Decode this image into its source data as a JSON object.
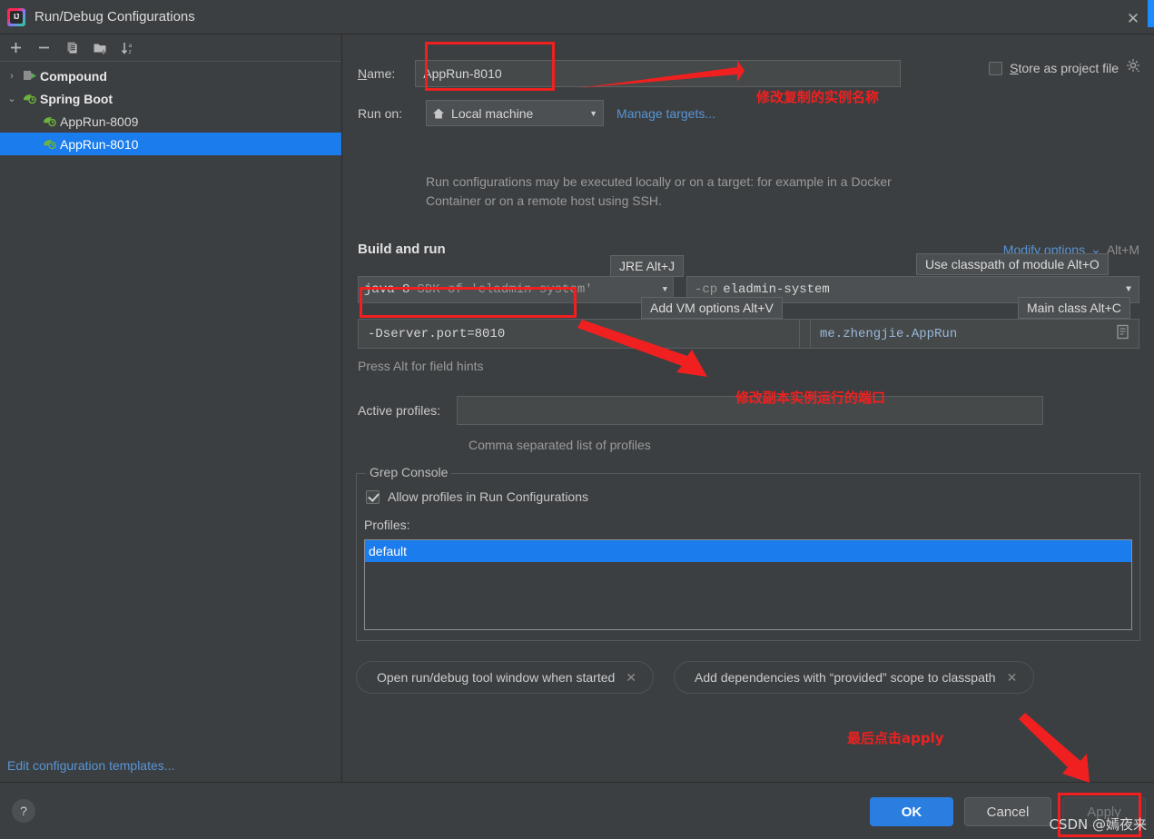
{
  "window": {
    "title": "Run/Debug Configurations",
    "logo_icon": "intellij-idea-logo",
    "close_icon": "close-icon"
  },
  "sidebar": {
    "toolbar": [
      {
        "name": "add-configuration-button",
        "icon": "plus-icon",
        "label": "+"
      },
      {
        "name": "remove-configuration-button",
        "icon": "minus-icon",
        "label": "−"
      },
      {
        "name": "copy-configuration-button",
        "icon": "copy-icon",
        "label": "copy"
      },
      {
        "name": "new-folder-button",
        "icon": "folder-add-icon",
        "label": "folder"
      },
      {
        "name": "sort-configurations-button",
        "icon": "sort-alphabetically-icon",
        "label": "sort"
      }
    ],
    "tree": [
      {
        "label": "Compound",
        "icon": "compound-icon",
        "twisty": "›",
        "bold": true,
        "selected": false,
        "child": false
      },
      {
        "label": "Spring Boot",
        "icon": "spring-boot-icon",
        "twisty": "⌄",
        "bold": true,
        "selected": false,
        "child": false
      },
      {
        "label": "AppRun-8009",
        "icon": "spring-boot-icon",
        "twisty": "",
        "bold": false,
        "selected": false,
        "child": true
      },
      {
        "label": "AppRun-8010",
        "icon": "spring-boot-icon",
        "twisty": "",
        "bold": false,
        "selected": true,
        "child": true
      }
    ],
    "edit_templates_link": "Edit configuration templates..."
  },
  "form": {
    "name_label": "Name:",
    "name_value": "AppRun-8010",
    "run_on_label": "Run on:",
    "run_on_value": "Local machine",
    "run_on_icon": "home-icon",
    "manage_targets_link": "Manage targets...",
    "description": "Run configurations may be executed locally or on a target: for example in a Docker Container or on a remote host using SSH.",
    "store_as_project_file_label": "Store as project file",
    "store_as_project_file_checked": false,
    "store_gear_icon": "gear-icon",
    "section_title": "Build and run",
    "modify_options_label": "Modify options",
    "modify_options_caret": "⌄",
    "modify_options_shortcut": "Alt+M",
    "sdk_prefix": "java 8",
    "sdk_value": "SDK of 'eladmin-system'",
    "classpath_prefix": "-cp",
    "classpath_value": "eladmin-system",
    "vm_options_value": "-Dserver.port=8010",
    "vm_expand_icon": "expand-icon",
    "vm_list_icon": "document-icon",
    "main_class_value": "me.zhengjie.AppRun",
    "main_class_icon": "document-icon",
    "field_hint": "Press Alt for field hints",
    "active_profiles_label": "Active profiles:",
    "active_profiles_value": "",
    "active_profiles_hint": "Comma separated list of profiles"
  },
  "tooltips": [
    {
      "name": "tooltip-jre",
      "text": "JRE Alt+J"
    },
    {
      "name": "tooltip-add-vm-options",
      "text": "Add VM options Alt+V"
    },
    {
      "name": "tooltip-use-classpath-of-module",
      "text": "Use classpath of module Alt+O"
    },
    {
      "name": "tooltip-main-class",
      "text": "Main class Alt+C"
    }
  ],
  "grep_console": {
    "legend": "Grep Console",
    "allow_profiles_label": "Allow profiles in Run Configurations",
    "allow_profiles_checked": true,
    "profiles_label": "Profiles:",
    "profiles_items": [
      {
        "label": "default",
        "selected": true
      }
    ]
  },
  "option_chips": [
    {
      "name": "chip-open-run-debug-tool-window",
      "label": "Open run/debug tool window when started",
      "close_icon": "close-icon"
    },
    {
      "name": "chip-add-provided-dependencies",
      "label": "Add dependencies with “provided” scope to classpath",
      "close_icon": "close-icon"
    }
  ],
  "footer": {
    "help_label": "?",
    "ok_label": "OK",
    "cancel_label": "Cancel",
    "apply_label": "Apply"
  },
  "annotations": [
    {
      "name": "annotation-rename-instance",
      "text": "修改复制的实例名称"
    },
    {
      "name": "annotation-change-port",
      "text": "修改副本实例运行的端口"
    },
    {
      "name": "annotation-click-apply",
      "text": "最后点击apply"
    }
  ],
  "watermark": "CSDN @嫣夜来",
  "colors": {
    "accent_blue": "#1a7ced",
    "link_blue": "#5894d4",
    "annotation_red": "#f02020",
    "background": "#3c3f41"
  }
}
